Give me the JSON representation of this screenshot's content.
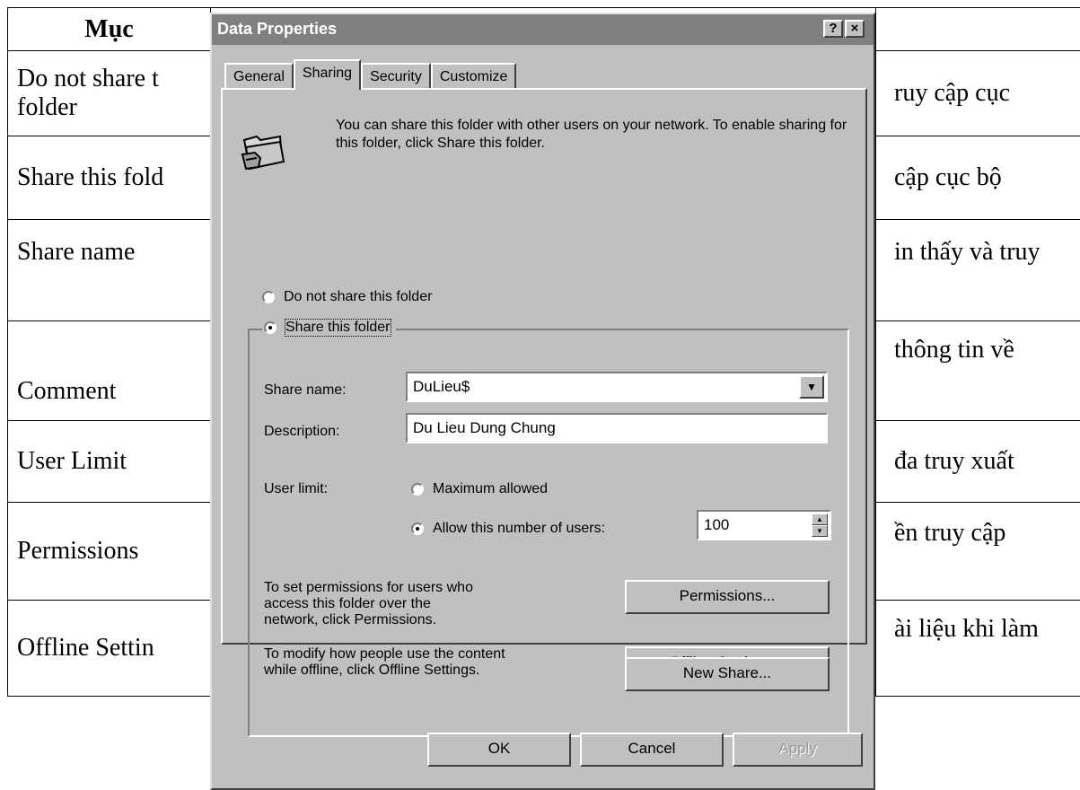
{
  "document": {
    "header": "Mục",
    "rows": [
      {
        "left": "Do not share t",
        "left2": "folder",
        "right": "ruy cập cục"
      },
      {
        "left": "Share this fold",
        "right": "cập cục bộ"
      },
      {
        "left": "Share name",
        "right": "in thấy và truy"
      },
      {
        "left": "Comment",
        "right": "thông tin về"
      },
      {
        "left": "User Limit",
        "right": "đa truy xuất"
      },
      {
        "left": "Permissions",
        "right": "ền truy cập"
      },
      {
        "left": "Offline Settin",
        "right": "ài liệu khi làm"
      }
    ]
  },
  "dialog": {
    "title": "Data Properties",
    "help_label": "?",
    "close_label": "×",
    "tabs": [
      {
        "label": "General",
        "active": false
      },
      {
        "label": "Sharing",
        "active": true
      },
      {
        "label": "Security",
        "active": false
      },
      {
        "label": "Customize",
        "active": false
      }
    ],
    "intro_text": "You can share this folder with other users on your network.  To enable sharing for this folder, click Share this folder.",
    "radio_not_share": "Do not share this folder",
    "radio_share": "Share this folder",
    "share_name_label": "Share name:",
    "share_name_value": "DuLieu$",
    "description_label": "Description:",
    "description_value": "Du Lieu Dung Chung",
    "user_limit_label": "User limit:",
    "max_allowed_label": "Maximum allowed",
    "allow_number_label": "Allow this number of users:",
    "user_count_value": "100",
    "permissions_text": "To set permissions for users who access this folder over the network, click Permissions.",
    "permissions_button": "Permissions...",
    "offline_text": "To modify how people use the content while offline, click Offline Settings.",
    "offline_button": "Offline Settings...",
    "new_share_button": "New Share...",
    "ok_button": "OK",
    "cancel_button": "Cancel",
    "apply_button": "Apply",
    "selected_radio": "share",
    "selected_user_limit": "allow_number"
  },
  "icons": [
    "folder-share-icon",
    "dropdown-arrow-icon",
    "spin-up-icon",
    "spin-down-icon"
  ]
}
